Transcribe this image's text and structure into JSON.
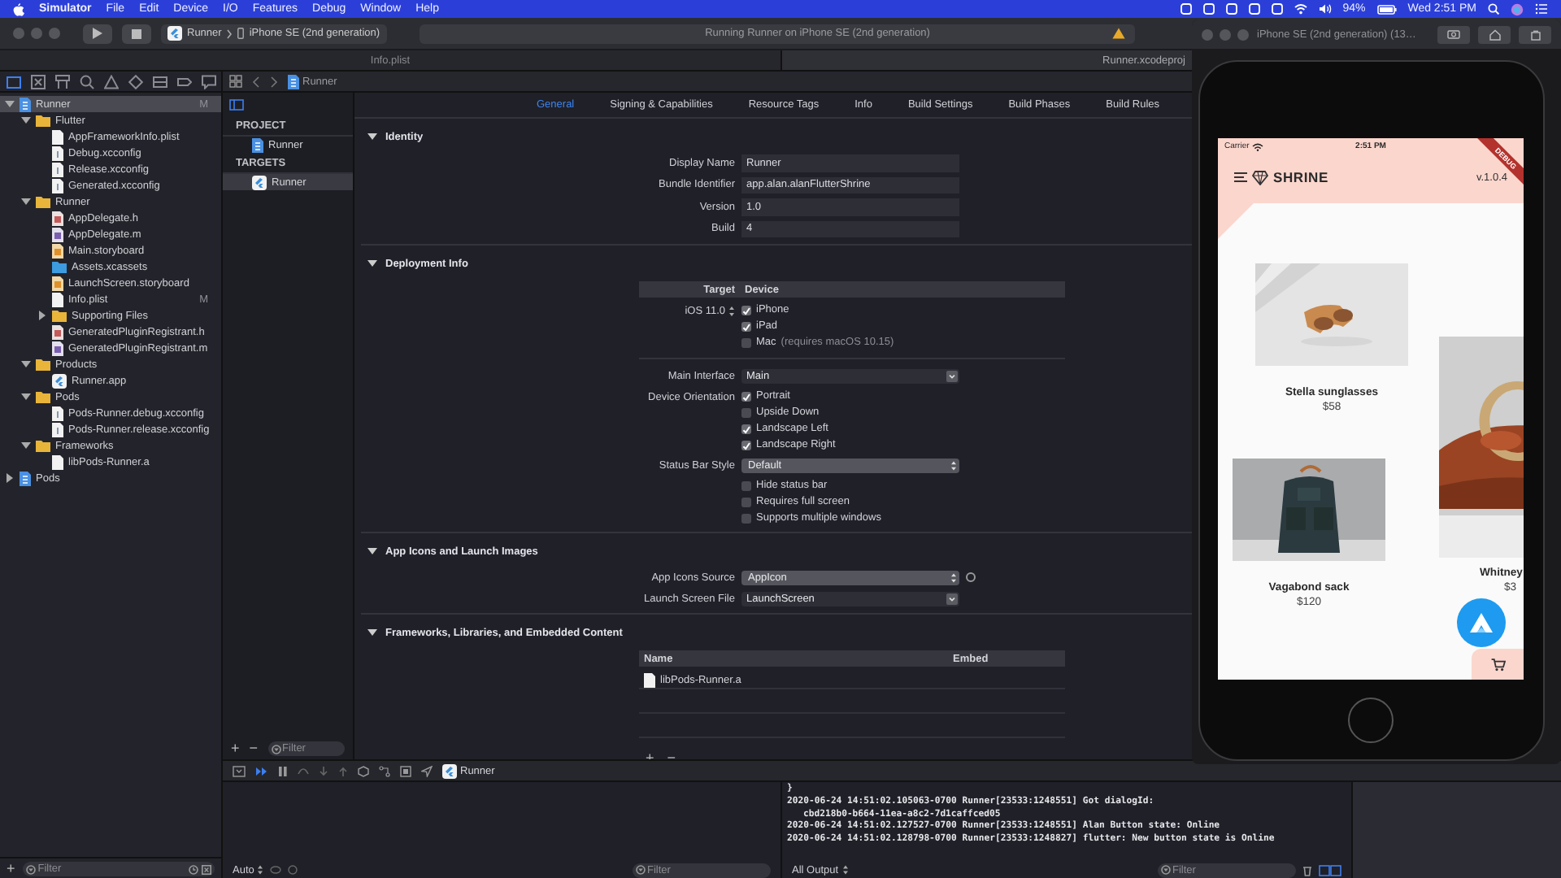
{
  "menubar": {
    "app": "Simulator",
    "items": [
      "File",
      "Edit",
      "Device",
      "I/O",
      "Features",
      "Debug",
      "Window",
      "Help"
    ],
    "battery": "94%",
    "clock": "Wed 2:51 PM"
  },
  "toolbar": {
    "scheme": "Runner",
    "device": "iPhone SE (2nd generation)",
    "activity": "Running Runner on iPhone SE (2nd generation)"
  },
  "editor_tabs": [
    {
      "label": "Info.plist",
      "selected": false
    },
    {
      "label": "Runner.xcodeproj",
      "selected": true
    }
  ],
  "navigator": {
    "tabs": [
      {
        "kind": "folder",
        "selected": true
      },
      {
        "kind": "box",
        "selected": false
      },
      {
        "kind": "hierarchy",
        "selected": false
      },
      {
        "kind": "search",
        "selected": false
      },
      {
        "kind": "warning",
        "selected": false
      },
      {
        "kind": "diamond",
        "selected": false
      },
      {
        "kind": "spray",
        "selected": false
      },
      {
        "kind": "tag",
        "selected": false
      },
      {
        "kind": "chat",
        "selected": false
      }
    ],
    "tree": [
      {
        "name": "Runner",
        "kind": "project",
        "badge": "M",
        "selected": true,
        "expanded": true,
        "children": [
          {
            "name": "Flutter",
            "kind": "folder",
            "selected": false,
            "expanded": true,
            "children": [
              {
                "name": "AppFrameworkInfo.plist",
                "kind": "plist",
                "selected": false
              },
              {
                "name": "Debug.xcconfig",
                "kind": "config",
                "selected": false
              },
              {
                "name": "Release.xcconfig",
                "kind": "config",
                "selected": false
              },
              {
                "name": "Generated.xcconfig",
                "kind": "config",
                "selected": false
              }
            ]
          },
          {
            "name": "Runner",
            "kind": "folder",
            "selected": false,
            "expanded": true,
            "children": [
              {
                "name": "AppDelegate.h",
                "kind": "header",
                "selected": false
              },
              {
                "name": "AppDelegate.m",
                "kind": "source",
                "selected": false
              },
              {
                "name": "Main.storyboard",
                "kind": "storyboard",
                "selected": false
              },
              {
                "name": "Assets.xcassets",
                "kind": "assets",
                "selected": false
              },
              {
                "name": "LaunchScreen.storyboard",
                "kind": "storyboard",
                "selected": false
              },
              {
                "name": "Info.plist",
                "kind": "plist",
                "badge": "M",
                "selected": false
              },
              {
                "name": "Supporting Files",
                "kind": "folder",
                "selected": false,
                "expanded": false
              },
              {
                "name": "GeneratedPluginRegistrant.h",
                "kind": "header",
                "selected": false
              },
              {
                "name": "GeneratedPluginRegistrant.m",
                "kind": "source",
                "selected": false
              }
            ]
          },
          {
            "name": "Products",
            "kind": "folder",
            "selected": false,
            "expanded": true,
            "children": [
              {
                "name": "Runner.app",
                "kind": "app",
                "selected": false
              }
            ]
          },
          {
            "name": "Pods",
            "kind": "folder",
            "selected": false,
            "expanded": true,
            "children": [
              {
                "name": "Pods-Runner.debug.xcconfig",
                "kind": "config",
                "selected": false
              },
              {
                "name": "Pods-Runner.release.xcconfig",
                "kind": "config",
                "selected": false
              }
            ]
          },
          {
            "name": "Frameworks",
            "kind": "folder",
            "selected": false,
            "expanded": true,
            "children": [
              {
                "name": "libPods-Runner.a",
                "kind": "plist",
                "selected": false
              }
            ]
          }
        ]
      },
      {
        "name": "Pods",
        "kind": "project",
        "selected": false,
        "expanded": false
      }
    ],
    "add": "+",
    "filter_placeholder": "Filter"
  },
  "jump_bar": "Runner",
  "targets_list": {
    "sections": [
      {
        "title": "PROJECT",
        "items": [
          {
            "name": "Runner",
            "kind": "project",
            "selected": false
          }
        ]
      },
      {
        "title": "TARGETS",
        "items": [
          {
            "name": "Runner",
            "kind": "app",
            "selected": true
          }
        ]
      }
    ],
    "buttons": [
      "+",
      "−"
    ],
    "filter_placeholder": "Filter"
  },
  "settings_tabs": [
    {
      "label": "General",
      "selected": true
    },
    {
      "label": "Signing & Capabilities",
      "selected": false
    },
    {
      "label": "Resource Tags",
      "selected": false
    },
    {
      "label": "Info",
      "selected": false
    },
    {
      "label": "Build Settings",
      "selected": false
    },
    {
      "label": "Build Phases",
      "selected": false
    },
    {
      "label": "Build Rules",
      "selected": false
    }
  ],
  "sections": [
    {
      "title": "Identity",
      "expanded": true,
      "rows": [
        {
          "kind": "text",
          "label": "Display Name",
          "value": "Runner"
        },
        {
          "kind": "text",
          "label": "Bundle Identifier",
          "value": "app.alan.alanFlutterShrine"
        },
        {
          "kind": "text",
          "label": "Version",
          "value": "1.0"
        },
        {
          "kind": "text",
          "label": "Build",
          "value": "4"
        }
      ]
    },
    {
      "title": "Deployment Info",
      "expanded": true,
      "rows": [
        {
          "kind": "header",
          "cells": [
            "Target",
            "Device"
          ]
        },
        {
          "kind": "checks",
          "label": "iOS 11.0",
          "stepper": true,
          "items": [
            {
              "label": "iPhone",
              "checked": true
            },
            {
              "label": "iPad",
              "checked": true
            },
            {
              "label": "Mac",
              "note": "(requires macOS 10.15)",
              "checked": false
            }
          ]
        },
        {
          "kind": "divider"
        },
        {
          "kind": "combo",
          "label": "Main Interface",
          "value": "Main"
        },
        {
          "kind": "checks",
          "label": "Device Orientation",
          "items": [
            {
              "label": "Portrait",
              "checked": true
            },
            {
              "label": "Upside Down",
              "checked": false
            },
            {
              "label": "Landscape Left",
              "checked": true
            },
            {
              "label": "Landscape Right",
              "checked": true
            }
          ]
        },
        {
          "kind": "popup",
          "label": "Status Bar Style",
          "value": "Default"
        },
        {
          "kind": "checks",
          "items": [
            {
              "label": "Hide status bar",
              "checked": false
            },
            {
              "label": "Requires full screen",
              "checked": false
            },
            {
              "label": "Supports multiple windows",
              "checked": false
            }
          ]
        }
      ]
    },
    {
      "title": "App Icons and Launch Images",
      "expanded": true,
      "rows": [
        {
          "kind": "popup",
          "label": "App Icons Source",
          "value": "AppIcon",
          "info_button": true
        },
        {
          "kind": "combo",
          "label": "Launch Screen File",
          "value": "LaunchScreen"
        }
      ]
    },
    {
      "title": "Frameworks, Libraries, and Embedded Content",
      "expanded": true,
      "rows": [
        {
          "kind": "header",
          "cells": [
            "Name",
            "Embed"
          ]
        },
        {
          "kind": "file",
          "name": "libPods-Runner.a"
        }
      ],
      "buttons": [
        "+",
        "−"
      ]
    }
  ],
  "debug_bar": {
    "scheme": "Runner"
  },
  "console": {
    "lines": [
      {
        "kind": "line",
        "text": "}"
      },
      {
        "kind": "line",
        "text": "2020-06-24 14:51:02.105063-0700 Runner[23533:1248551] Got dialogId:"
      },
      {
        "kind": "wrap",
        "text": "cbd218b0-b664-11ea-a8c2-7d1caffced05"
      },
      {
        "kind": "line",
        "text": "2020-06-24 14:51:02.127527-0700 Runner[23533:1248551] Alan Button state: Online"
      },
      {
        "kind": "line",
        "text": "2020-06-24 14:51:02.128798-0700 Runner[23533:1248827] flutter: New button state is Online"
      }
    ],
    "output": "All Output",
    "filter_placeholder": "Filter"
  },
  "variables": {
    "scope": "Auto",
    "filter_placeholder": "Filter"
  },
  "simulator": {
    "title": "iPhone SE (2nd generation) (13…",
    "carrier": "Carrier",
    "time": "2:51 PM",
    "app_title": "SHRINE",
    "version": "v.1.0.4",
    "banner": "DEBUG",
    "products": [
      {
        "name": "Stella sunglasses",
        "price": "$58"
      },
      {
        "name": "Vagabond sack",
        "price": "$120"
      },
      {
        "name": "Whitney",
        "price": "$3"
      }
    ]
  }
}
